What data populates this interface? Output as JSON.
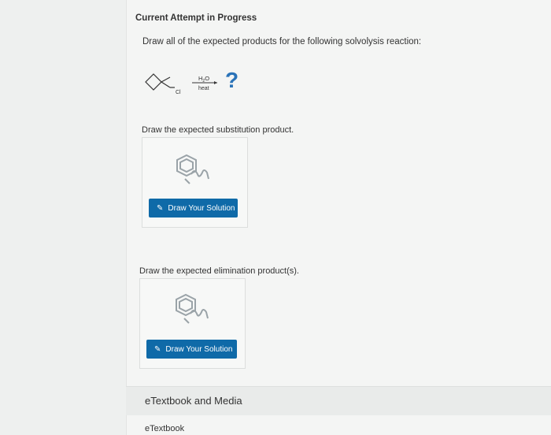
{
  "header": {
    "title": "Current Attempt in Progress"
  },
  "question": {
    "prompt": "Draw all of the expected products for the following solvolysis reaction:",
    "reagent_top": "H2O",
    "reagent_bottom": "heat",
    "leaving_group": "Cl",
    "product_placeholder": "?"
  },
  "substitution": {
    "label": "Draw the expected substitution product.",
    "button_label": "Draw Your Solution"
  },
  "elimination": {
    "label": "Draw the expected elimination product(s).",
    "button_label": "Draw Your Solution"
  },
  "resources": {
    "title": "eTextbook and Media",
    "link": "eTextbook"
  },
  "colors": {
    "button": "#0f6aa8",
    "question_mark": "#2a73b8"
  },
  "icons": [
    "molecule-editor-icon",
    "pencil-icon"
  ]
}
